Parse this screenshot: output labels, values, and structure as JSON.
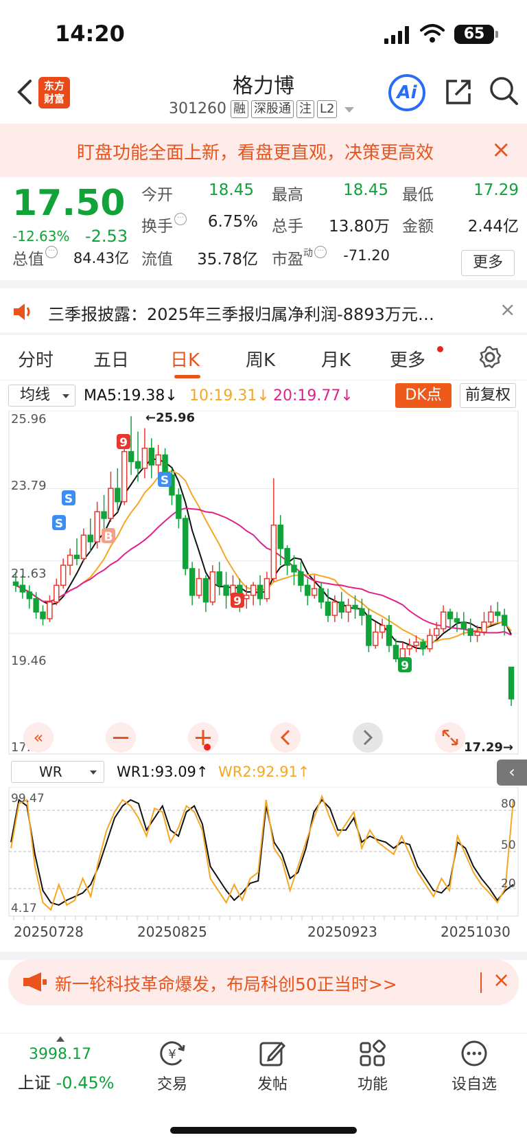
{
  "status": {
    "time": "14:20",
    "battery": "65"
  },
  "header": {
    "logo_line1": "东方",
    "logo_line2": "财富",
    "name": "格力博",
    "code": "301260",
    "tags": [
      "融",
      "深股通",
      "注",
      "L2"
    ],
    "ai_label": "Ai"
  },
  "banner": {
    "text": "盯盘功能全面上新，看盘更直观，决策更高效",
    "close": "×"
  },
  "quote": {
    "price": "17.50",
    "pct": "-12.63%",
    "change": "-2.53",
    "open_label": "今开",
    "open": "18.45",
    "high_label": "最高",
    "high": "18.45",
    "low_label": "最低",
    "low": "17.29",
    "turnover_label": "换手",
    "turnover": "6.75%",
    "volume_label": "总手",
    "volume": "13.80万",
    "amount_label": "金额",
    "amount": "2.44亿",
    "mcap_label": "总值",
    "mcap": "84.43亿",
    "float_label": "流值",
    "float": "35.78亿",
    "pe_label": "市盈",
    "pe_sup": "动",
    "pe": "-71.20",
    "more": "更多"
  },
  "news": {
    "text": "三季报披露：2025年三季报归属净利润-8893万元…",
    "close": "×"
  },
  "tabs": [
    "分时",
    "五日",
    "日K",
    "周K",
    "月K",
    "更多"
  ],
  "active_tab": "日K",
  "ma_bar": {
    "selector": "均线",
    "ma5": "MA5:19.38↓",
    "ma10": "10:19.31↓",
    "ma20": "20:19.77↓",
    "dk": "DK点",
    "adjust": "前复权",
    "colors": {
      "ma5": "#111111",
      "ma10": "#f5a623",
      "ma20": "#e0218a"
    }
  },
  "kchart": {
    "y_labels": [
      "25.96",
      "23.79",
      "21.63",
      "19.46",
      "17.29"
    ],
    "high_marker": "←25.96",
    "low_marker": "17.29→",
    "signals": [
      {
        "t": "S",
        "kind": "s"
      },
      {
        "t": "S",
        "kind": "s"
      },
      {
        "t": "S",
        "kind": "s"
      },
      {
        "t": "B",
        "kind": "b"
      },
      {
        "t": "9",
        "kind": "n9"
      },
      {
        "t": "9",
        "kind": "n9"
      },
      {
        "t": "9",
        "kind": "n9g"
      }
    ]
  },
  "wr_bar": {
    "selector": "WR",
    "wr1": "WR1:93.09↑",
    "wr2": "WR2:92.91↑",
    "colors": {
      "wr1": "#111111",
      "wr2": "#f5a623"
    },
    "y_labels": [
      "99.47",
      "4.17"
    ],
    "right_labels": [
      "80",
      "50",
      "20"
    ],
    "dates": [
      "20250728",
      "20250825",
      "20250923",
      "20251030"
    ]
  },
  "ad": {
    "text": "新一轮科技革命爆发，布局科创50正当时>>",
    "close": "×"
  },
  "bottom_nav": {
    "index_value": "3998.17",
    "index_name": "上证",
    "index_pct": "-0.45%",
    "items": [
      "交易",
      "发帖",
      "功能",
      "设自选"
    ]
  },
  "chart_data": {
    "type": "candlestick",
    "y_range": [
      17.29,
      25.96
    ],
    "high": 25.96,
    "low": 17.29,
    "series": [
      {
        "name": "MA5",
        "last": 19.38
      },
      {
        "name": "10",
        "last": 19.31
      },
      {
        "name": "20",
        "last": 19.77
      }
    ],
    "candles": [
      [
        21.0,
        20.9,
        21.3,
        20.7
      ],
      [
        20.9,
        20.7,
        21.2,
        20.5
      ],
      [
        20.7,
        20.5,
        20.9,
        20.2
      ],
      [
        20.5,
        20.1,
        20.7,
        19.9
      ],
      [
        20.1,
        19.9,
        20.3,
        19.7
      ],
      [
        19.9,
        20.4,
        20.6,
        19.8
      ],
      [
        20.4,
        20.9,
        21.1,
        20.3
      ],
      [
        20.9,
        21.5,
        21.7,
        20.8
      ],
      [
        21.5,
        21.8,
        22.0,
        21.2
      ],
      [
        21.8,
        21.7,
        22.3,
        21.5
      ],
      [
        21.7,
        22.4,
        22.6,
        21.6
      ],
      [
        22.4,
        22.2,
        22.9,
        21.9
      ],
      [
        22.2,
        23.1,
        23.4,
        22.0
      ],
      [
        23.1,
        22.9,
        23.6,
        22.6
      ],
      [
        22.9,
        23.8,
        24.3,
        22.8
      ],
      [
        23.8,
        23.4,
        24.4,
        23.1
      ],
      [
        23.4,
        24.9,
        25.4,
        23.3
      ],
      [
        24.9,
        24.6,
        25.96,
        24.2
      ],
      [
        24.6,
        24.4,
        25.5,
        24.0
      ],
      [
        24.4,
        25.0,
        25.6,
        24.1
      ],
      [
        25.0,
        24.5,
        25.3,
        24.1
      ],
      [
        24.5,
        24.8,
        25.1,
        24.2
      ],
      [
        24.8,
        24.2,
        25.0,
        23.9
      ],
      [
        24.2,
        23.6,
        24.4,
        23.3
      ],
      [
        23.6,
        22.9,
        23.8,
        22.6
      ],
      [
        22.9,
        21.4,
        23.0,
        21.2
      ],
      [
        21.4,
        20.6,
        21.6,
        20.3
      ],
      [
        20.6,
        21.1,
        21.4,
        20.5
      ],
      [
        21.1,
        20.4,
        21.2,
        20.1
      ],
      [
        20.4,
        21.3,
        21.5,
        20.3
      ],
      [
        21.3,
        20.9,
        21.6,
        20.6
      ],
      [
        20.9,
        20.6,
        21.3,
        20.2
      ],
      [
        20.6,
        20.9,
        21.2,
        20.5
      ],
      [
        20.9,
        20.5,
        21.1,
        20.1
      ],
      [
        20.5,
        20.6,
        20.9,
        20.2
      ],
      [
        20.6,
        20.9,
        21.0,
        20.3
      ],
      [
        20.9,
        20.5,
        21.2,
        20.3
      ],
      [
        20.5,
        21.1,
        21.3,
        20.4
      ],
      [
        21.1,
        22.7,
        24.1,
        21.0
      ],
      [
        22.7,
        22.0,
        23.0,
        21.5
      ],
      [
        22.0,
        21.5,
        22.1,
        21.2
      ],
      [
        21.5,
        21.3,
        21.8,
        20.9
      ],
      [
        21.3,
        20.9,
        21.6,
        20.7
      ],
      [
        20.9,
        20.6,
        21.1,
        20.3
      ],
      [
        20.6,
        20.8,
        21.2,
        20.5
      ],
      [
        20.8,
        20.4,
        21.0,
        20.2
      ],
      [
        20.4,
        20.0,
        20.8,
        19.8
      ],
      [
        20.0,
        20.4,
        20.6,
        19.8
      ],
      [
        20.4,
        20.1,
        20.7,
        19.9
      ],
      [
        20.1,
        20.3,
        20.5,
        19.8
      ],
      [
        20.3,
        20.2,
        20.6,
        19.9
      ],
      [
        20.2,
        20.0,
        20.5,
        19.7
      ],
      [
        20.0,
        19.1,
        20.2,
        18.9
      ],
      [
        19.1,
        19.5,
        19.8,
        19.0
      ],
      [
        19.5,
        19.7,
        19.9,
        19.3
      ],
      [
        19.7,
        19.1,
        20.0,
        18.9
      ],
      [
        19.1,
        18.7,
        19.3,
        18.6
      ],
      [
        18.7,
        19.0,
        19.2,
        18.6
      ],
      [
        19.0,
        19.1,
        19.3,
        18.8
      ],
      [
        19.1,
        19.2,
        19.4,
        18.9
      ],
      [
        19.2,
        19.0,
        19.3,
        18.8
      ],
      [
        19.0,
        19.4,
        19.6,
        18.9
      ],
      [
        19.4,
        19.6,
        19.8,
        19.3
      ],
      [
        19.6,
        20.1,
        20.3,
        19.5
      ],
      [
        20.1,
        19.9,
        20.2,
        19.6
      ],
      [
        19.9,
        19.8,
        20.1,
        19.5
      ],
      [
        19.8,
        19.6,
        20.1,
        19.4
      ],
      [
        19.6,
        19.4,
        19.9,
        19.2
      ],
      [
        19.4,
        19.5,
        19.7,
        19.2
      ],
      [
        19.5,
        19.8,
        20.1,
        19.4
      ],
      [
        19.8,
        20.1,
        20.3,
        19.7
      ],
      [
        20.1,
        20.0,
        20.4,
        19.8
      ],
      [
        20.0,
        19.7,
        20.2,
        19.4
      ],
      [
        18.45,
        17.5,
        18.45,
        17.29
      ]
    ],
    "wr1": [
      60,
      95,
      90,
      50,
      20,
      10,
      8,
      12,
      15,
      18,
      25,
      40,
      60,
      80,
      90,
      95,
      92,
      70,
      80,
      90,
      70,
      65,
      85,
      90,
      75,
      40,
      30,
      20,
      12,
      18,
      26,
      28,
      90,
      60,
      50,
      30,
      35,
      55,
      85,
      95,
      88,
      70,
      70,
      80,
      60,
      65,
      62,
      60,
      55,
      60,
      58,
      40,
      30,
      20,
      18,
      25,
      60,
      55,
      40,
      30,
      22,
      12,
      20,
      25
    ],
    "wr2": [
      55,
      92,
      95,
      40,
      10,
      4,
      25,
      8,
      12,
      30,
      15,
      45,
      70,
      85,
      95,
      90,
      80,
      65,
      88,
      85,
      60,
      72,
      90,
      85,
      70,
      30,
      20,
      10,
      25,
      12,
      30,
      35,
      95,
      55,
      45,
      20,
      40,
      60,
      80,
      98,
      80,
      65,
      75,
      85,
      55,
      70,
      60,
      55,
      50,
      65,
      50,
      35,
      25,
      15,
      30,
      20,
      65,
      50,
      35,
      25,
      18,
      10,
      22,
      95
    ]
  }
}
